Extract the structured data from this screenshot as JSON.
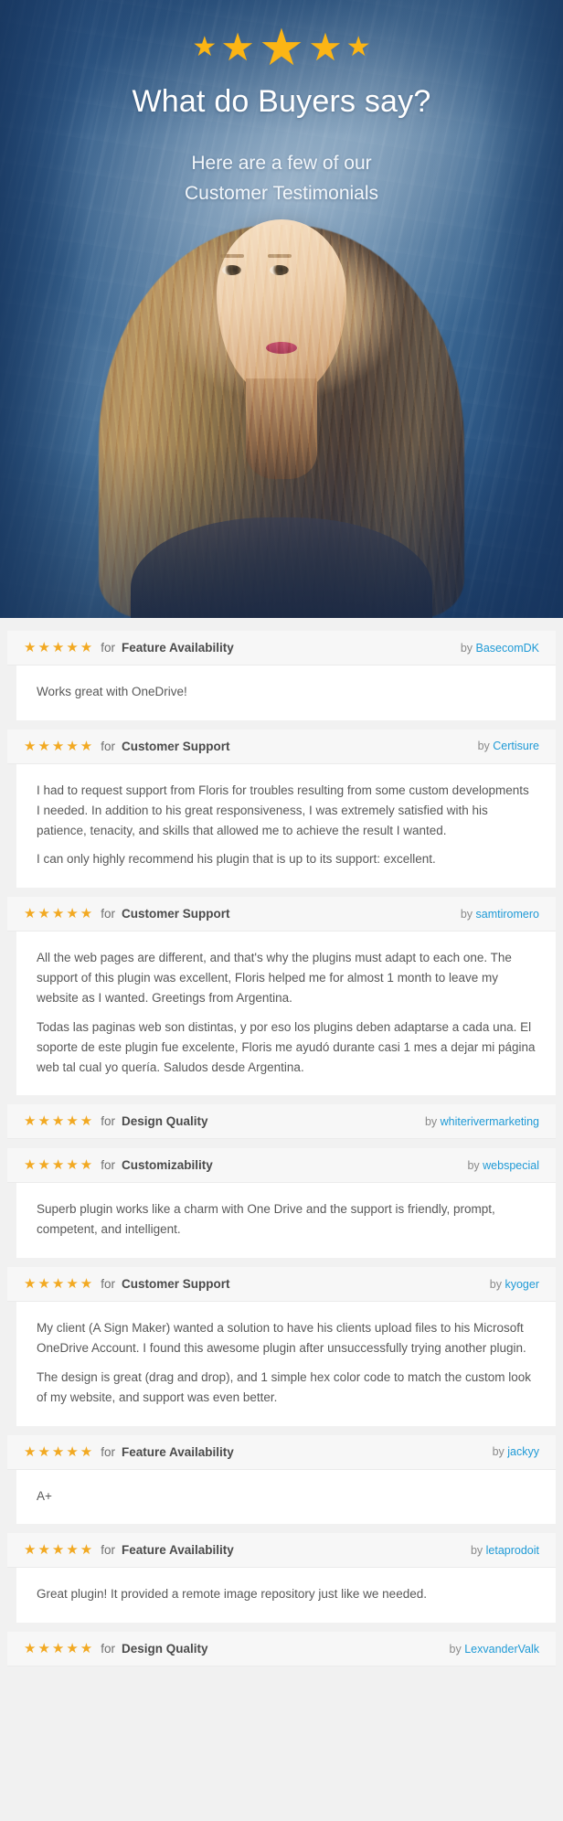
{
  "hero": {
    "stars": [
      "★",
      "★",
      "★",
      "★",
      "★"
    ],
    "title": "What do Buyers say?",
    "subtitle_line1": "Here are a few of our",
    "subtitle_line2": "Customer Testimonials",
    "star_color": "#fcb514",
    "bg_color": "#2a5583"
  },
  "colors": {
    "star": "#f2a922",
    "link": "#1f9ad6",
    "body_text": "#585858",
    "page_bg": "#f1f1f1",
    "header_bg": "#f7f7f7"
  },
  "labels": {
    "for": "for",
    "by": "by"
  },
  "reviews": [
    {
      "stars": "★★★★★",
      "rating": 5,
      "criteria": "Feature Availability",
      "author": "BasecomDK",
      "paragraphs": [
        "Works great with OneDrive!"
      ]
    },
    {
      "stars": "★★★★★",
      "rating": 5,
      "criteria": "Customer Support",
      "author": "Certisure",
      "paragraphs": [
        "I had to request support from Floris for troubles resulting from some custom developments I needed. In addition to his great responsiveness, I was extremely satisfied with his patience, tenacity, and skills that allowed me to achieve the result I wanted.",
        "I can only highly recommend his plugin that is up to its support: excellent."
      ]
    },
    {
      "stars": "★★★★★",
      "rating": 5,
      "criteria": "Customer Support",
      "author": "samtiromero",
      "paragraphs": [
        "All the web pages are different, and that's why the plugins must adapt to each one. The support of this plugin was excellent, Floris helped me for almost 1 month to leave my website as I wanted. Greetings from Argentina.",
        "Todas las paginas web son distintas, y por eso los plugins deben adaptarse a cada una. El soporte de este plugin fue excelente, Floris me ayudó durante casi 1 mes a dejar mi página web tal cual yo quería. Saludos desde Argentina."
      ]
    },
    {
      "stars": "★★★★★",
      "rating": 5,
      "criteria": "Design Quality",
      "author": "whiterivermarketing",
      "paragraphs": []
    },
    {
      "stars": "★★★★★",
      "rating": 5,
      "criteria": "Customizability",
      "author": "webspecial",
      "paragraphs": [
        "Superb plugin works like a charm with One Drive and the support is friendly, prompt, competent, and intelligent."
      ]
    },
    {
      "stars": "★★★★★",
      "rating": 5,
      "criteria": "Customer Support",
      "author": "kyoger",
      "paragraphs": [
        "My client (A Sign Maker) wanted a solution to have his clients upload files to his Microsoft OneDrive Account. I found this awesome plugin after unsuccessfully trying another plugin.",
        "The design is great (drag and drop), and 1 simple hex color code to match the custom look of my website, and support was even better."
      ]
    },
    {
      "stars": "★★★★★",
      "rating": 5,
      "criteria": "Feature Availability",
      "author": "jackyy",
      "paragraphs": [
        "A+"
      ]
    },
    {
      "stars": "★★★★★",
      "rating": 5,
      "criteria": "Feature Availability",
      "author": "letaprodoit",
      "paragraphs": [
        "Great plugin! It provided a remote image repository just like we needed."
      ]
    },
    {
      "stars": "★★★★★",
      "rating": 5,
      "criteria": "Design Quality",
      "author": "LexvanderValk",
      "paragraphs": []
    }
  ]
}
